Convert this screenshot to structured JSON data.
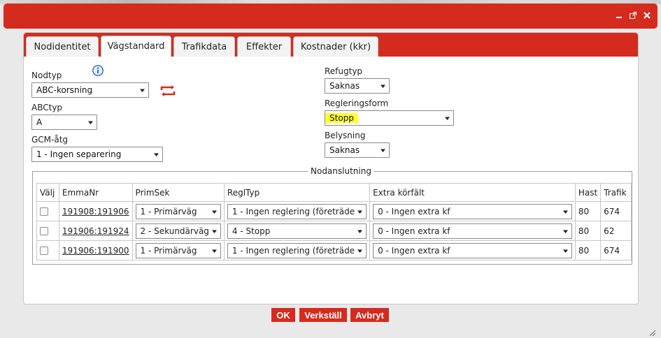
{
  "tabs": [
    {
      "label": "Nodidentitet",
      "active": false
    },
    {
      "label": "Vägstandard",
      "active": true
    },
    {
      "label": "Trafikdata",
      "active": false
    },
    {
      "label": "Effekter",
      "active": false
    },
    {
      "label": "Kostnader (kkr)",
      "active": false
    }
  ],
  "form": {
    "nodtyp": {
      "label": "Nodtyp",
      "value": "ABC-korsning"
    },
    "abctyp": {
      "label": "ABCtyp",
      "value": "A"
    },
    "gcm": {
      "label": "GCM-åtg",
      "value": "1 - Ingen separering"
    },
    "refugtyp": {
      "label": "Refugtyp",
      "value": "Saknas"
    },
    "regleringsform": {
      "label": "Regleringsform",
      "value": "Stopp"
    },
    "belysning": {
      "label": "Belysning",
      "value": "Saknas"
    }
  },
  "nodanslutning": {
    "legend": "Nodanslutning",
    "headers": [
      "Välj",
      "EmmaNr",
      "PrimSek",
      "ReglTyp",
      "Extra körfält",
      "Hast",
      "Trafik"
    ],
    "rows": [
      {
        "emmanr": "191908:191906",
        "primsek": "1 - Primärväg",
        "regltyp": "1 - Ingen reglering (företräde",
        "extra": "0 - Ingen extra kf",
        "hast": "80",
        "trafik": "674"
      },
      {
        "emmanr": "191906:191924",
        "primsek": "2 - Sekundärväg",
        "regltyp": "4 - Stopp",
        "extra": "0 - Ingen extra kf",
        "hast": "80",
        "trafik": "62"
      },
      {
        "emmanr": "191906:191900",
        "primsek": "1 - Primärväg",
        "regltyp": "1 - Ingen reglering (företräde",
        "extra": "0 - Ingen extra kf",
        "hast": "80",
        "trafik": "674"
      }
    ]
  },
  "buttons": {
    "ok": "OK",
    "apply": "Verkställ",
    "cancel": "Avbryt"
  },
  "colors": {
    "accent": "#d52b1e",
    "highlight": "#ffff33"
  }
}
